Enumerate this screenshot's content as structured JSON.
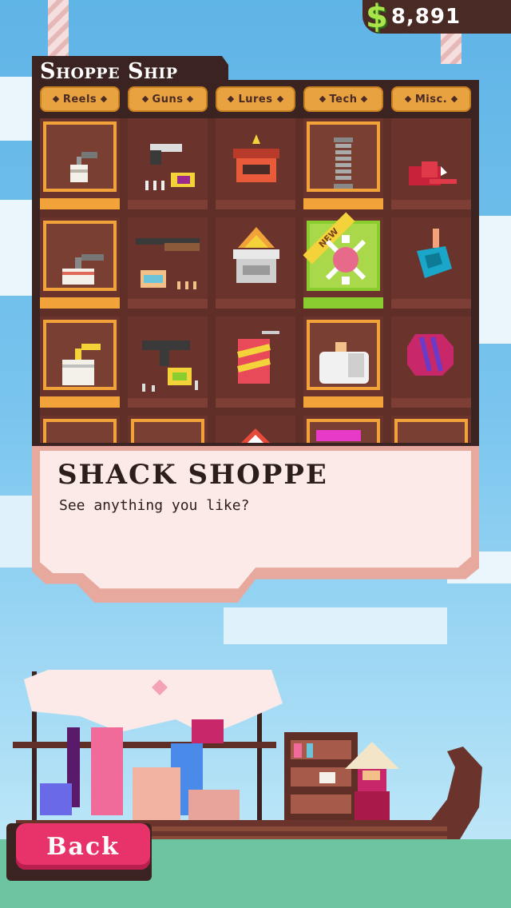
{
  "currency": {
    "symbol": "$",
    "amount": "8,891"
  },
  "shop": {
    "title": "Shoppe Ship",
    "tabs": [
      "Reels",
      "Guns",
      "Lures",
      "Tech",
      "Misc."
    ],
    "new_badge": "NEW"
  },
  "dialog": {
    "speaker": "SHACK SHOPPE",
    "message": "See anything you like?"
  },
  "back_label": "Back",
  "colors": {
    "wood_dark": "#3a2320",
    "accent_orange": "#f1a33a",
    "new_green": "#8acd2e",
    "back_pink": "#e8336a",
    "money_green": "#a9e44a"
  }
}
